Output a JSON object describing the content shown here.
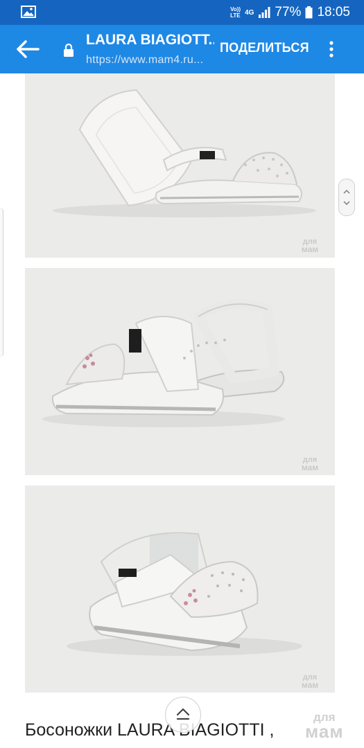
{
  "status_bar": {
    "network_top": "Vo))",
    "network_bottom": "LTE",
    "network_type": "4G",
    "battery": "77%",
    "time": "18:05",
    "icons": [
      "gallery-icon",
      "signal-icon",
      "battery-icon"
    ]
  },
  "app_bar": {
    "title": "LAURA BIAGIOTT...",
    "url": "https://www.mam4.ru...",
    "share_label": "ПОДЕЛИТЬСЯ",
    "icons": [
      "back-arrow-icon",
      "lock-icon",
      "more-vertical-icon"
    ]
  },
  "photos": [
    {
      "watermark_top": "для",
      "watermark_bottom": "мам"
    },
    {
      "watermark_top": "для",
      "watermark_bottom": "мам"
    },
    {
      "watermark_top": "для",
      "watermark_bottom": "мам"
    }
  ],
  "product": {
    "title": "Босоножки LAURA BIAGIOTTI ,"
  },
  "site_watermark": {
    "line1": "для",
    "line2": "мам"
  },
  "colors": {
    "status_bar": "#1565c0",
    "app_bar": "#1e88e5",
    "photo_background": "#ebebea"
  }
}
